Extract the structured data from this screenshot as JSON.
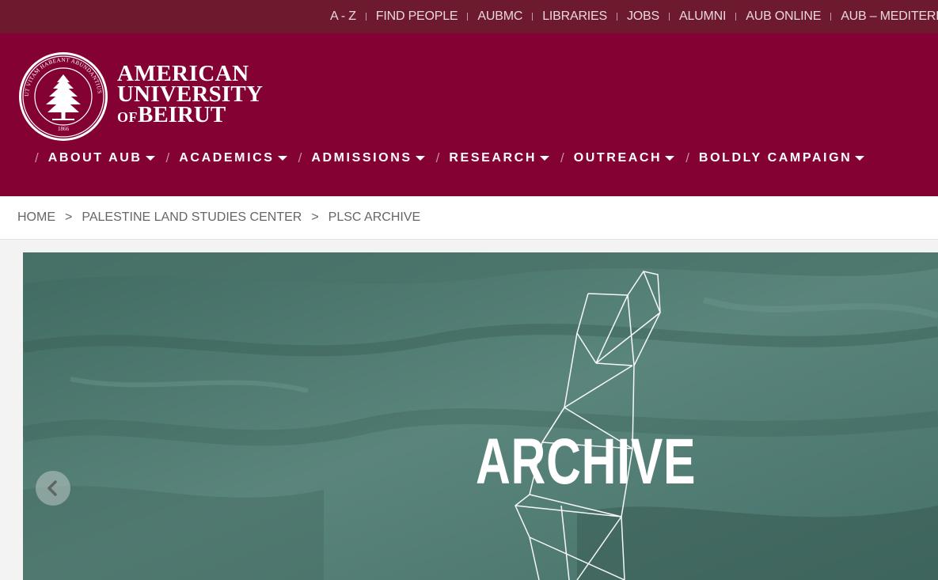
{
  "utility_nav": [
    "A - Z",
    "FIND PEOPLE",
    "AUBMC",
    "LIBRARIES",
    "JOBS",
    "ALUMNI",
    "AUB ONLINE",
    "AUB – MEDITERRANEO"
  ],
  "brand": {
    "line1": "AMERICAN",
    "line2": "UNIVERSITY",
    "line3_of": "OF",
    "line3": "BEIRUT",
    "seal_motto": "UT VITAM HABEANT ABUNDANTIUS HABEANT",
    "seal_year": "1866"
  },
  "main_nav": [
    "ABOUT AUB",
    "ACADEMICS",
    "ADMISSIONS",
    "RESEARCH",
    "OUTREACH",
    "BOLDLY CAMPAIGN"
  ],
  "breadcrumb": [
    "HOME",
    "PALESTINE LAND STUDIES CENTER",
    "PLSC ARCHIVE"
  ],
  "hero": {
    "title": "ARCHIVE"
  },
  "colors": {
    "brand": "#840233",
    "topbar": "#6e1a2e",
    "hero_tint": "#4f7a71"
  },
  "icons": {
    "prev": "chevron-left-icon",
    "dropdown": "caret-down-icon"
  }
}
